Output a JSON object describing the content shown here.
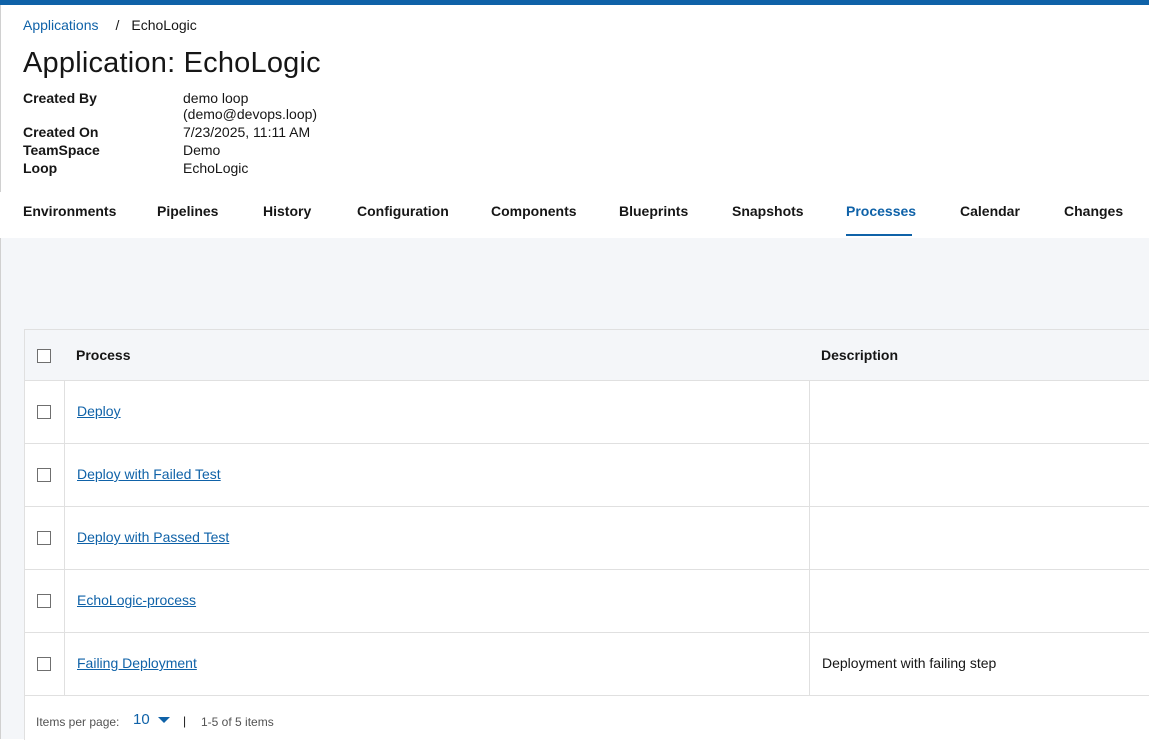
{
  "breadcrumb": {
    "parent": "Applications",
    "separator": "/",
    "current": "EchoLogic"
  },
  "page": {
    "title": "Application: EchoLogic"
  },
  "meta": {
    "created_by_label": "Created By",
    "created_by_value": "demo loop (demo@devops.loop)",
    "created_on_label": "Created On",
    "created_on_value": "7/23/2025, 11:11 AM",
    "teamspace_label": "TeamSpace",
    "teamspace_value": "Demo",
    "loop_label": "Loop",
    "loop_value": "EchoLogic"
  },
  "tabs": [
    {
      "label": "Environments"
    },
    {
      "label": "Pipelines"
    },
    {
      "label": "History"
    },
    {
      "label": "Configuration"
    },
    {
      "label": "Components"
    },
    {
      "label": "Blueprints"
    },
    {
      "label": "Snapshots"
    },
    {
      "label": "Processes",
      "active": true
    },
    {
      "label": "Calendar"
    },
    {
      "label": "Changes"
    }
  ],
  "table": {
    "headers": {
      "process": "Process",
      "description": "Description"
    },
    "rows": [
      {
        "process": "Deploy",
        "description": ""
      },
      {
        "process": "Deploy with Failed Test",
        "description": ""
      },
      {
        "process": "Deploy with Passed Test",
        "description": ""
      },
      {
        "process": "EchoLogic-process",
        "description": ""
      },
      {
        "process": "Failing Deployment",
        "description": "Deployment with failing step"
      }
    ]
  },
  "pagination": {
    "items_per_page_label": "Items per page:",
    "items_per_page_value": "10",
    "separator": "|",
    "range_text": "1-5 of 5 items"
  },
  "colors": {
    "accent": "#0f62a8",
    "content_background": "#f4f6f9",
    "border": "#e0e0e0"
  }
}
